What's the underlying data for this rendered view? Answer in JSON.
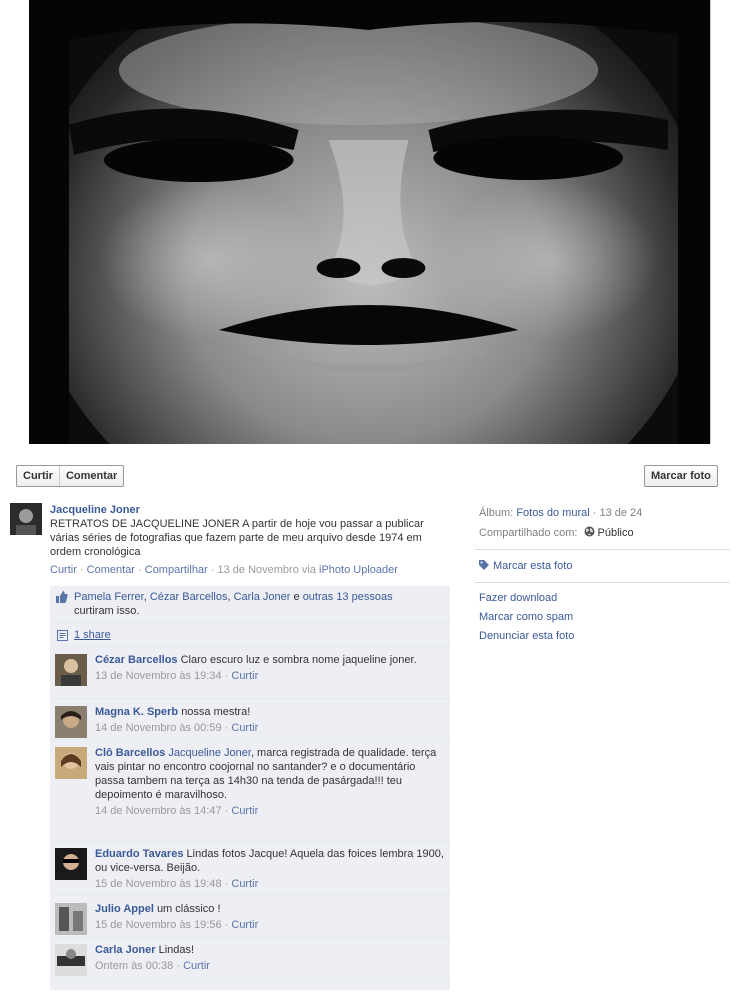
{
  "actions": {
    "like_label": "Curtir",
    "comment_label": "Comentar",
    "tag_label": "Marcar foto"
  },
  "post": {
    "author": "Jacqueline Joner",
    "text": "RETRATOS DE JACQUELINE JONER A partir de hoje vou passar a publicar várias séries de fotografias que fazem parte de meu arquivo desde 1974 em ordem cronológica",
    "meta": {
      "like": "Curtir",
      "comment": "Comentar",
      "share": "Compartilhar",
      "date": "13 de Novembro via",
      "app": "iPhoto Uploader"
    }
  },
  "likes": {
    "names": [
      "Pamela Ferrer",
      "Cézar Barcellos",
      "Carla Joner"
    ],
    "sep1": ", ",
    "sep2": ", ",
    "connector": " e ",
    "others": "outras 13 pessoas",
    "suffix": "curtiram isso."
  },
  "shares": {
    "label": "1 share"
  },
  "comments": [
    {
      "name": "Cézar Barcellos",
      "text": "Claro escuro luz e sombra nome jaqueline joner.",
      "time": "13 de Novembro às 19:34",
      "like": "Curtir"
    },
    {
      "name": "Magna K. Sperb",
      "text": "nossa mestra!",
      "time": "14 de Novembro às 00:59",
      "like": "Curtir"
    },
    {
      "name": "Clô Barcellos",
      "mention": "Jacqueline Joner",
      "text": ", marca registrada de qualidade. terça vais pintar no encontro coojornal no santander? e o documentário passa tambem na terça as 14h30 na tenda de pasárgada!!! teu depoimento é maravilhoso.",
      "time": "14 de Novembro às 14:47",
      "like": "Curtir"
    },
    {
      "name": "Eduardo Tavares",
      "text": "Lindas fotos Jacque! Aquela das foices lembra 1900, ou vice-versa. Beijão.",
      "time": "15 de Novembro às 19:48",
      "like": "Curtir"
    },
    {
      "name": "Julio Appel",
      "text": "um clássico !",
      "time": "15 de Novembro às 19:56",
      "like": "Curtir"
    },
    {
      "name": "Carla Joner",
      "text": "Lindas!",
      "time": "Ontem às 00:38",
      "like": "Curtir"
    }
  ],
  "sidebar": {
    "album_label": "Álbum:",
    "album_name": "Fotos do mural",
    "album_position": " · 13 de 24",
    "shared_label": "Compartilhado com:",
    "shared_value": "Público",
    "tag_photo": "Marcar esta foto",
    "download": "Fazer download",
    "spam": "Marcar como spam",
    "report": "Denunciar esta foto"
  },
  "separator": " · "
}
